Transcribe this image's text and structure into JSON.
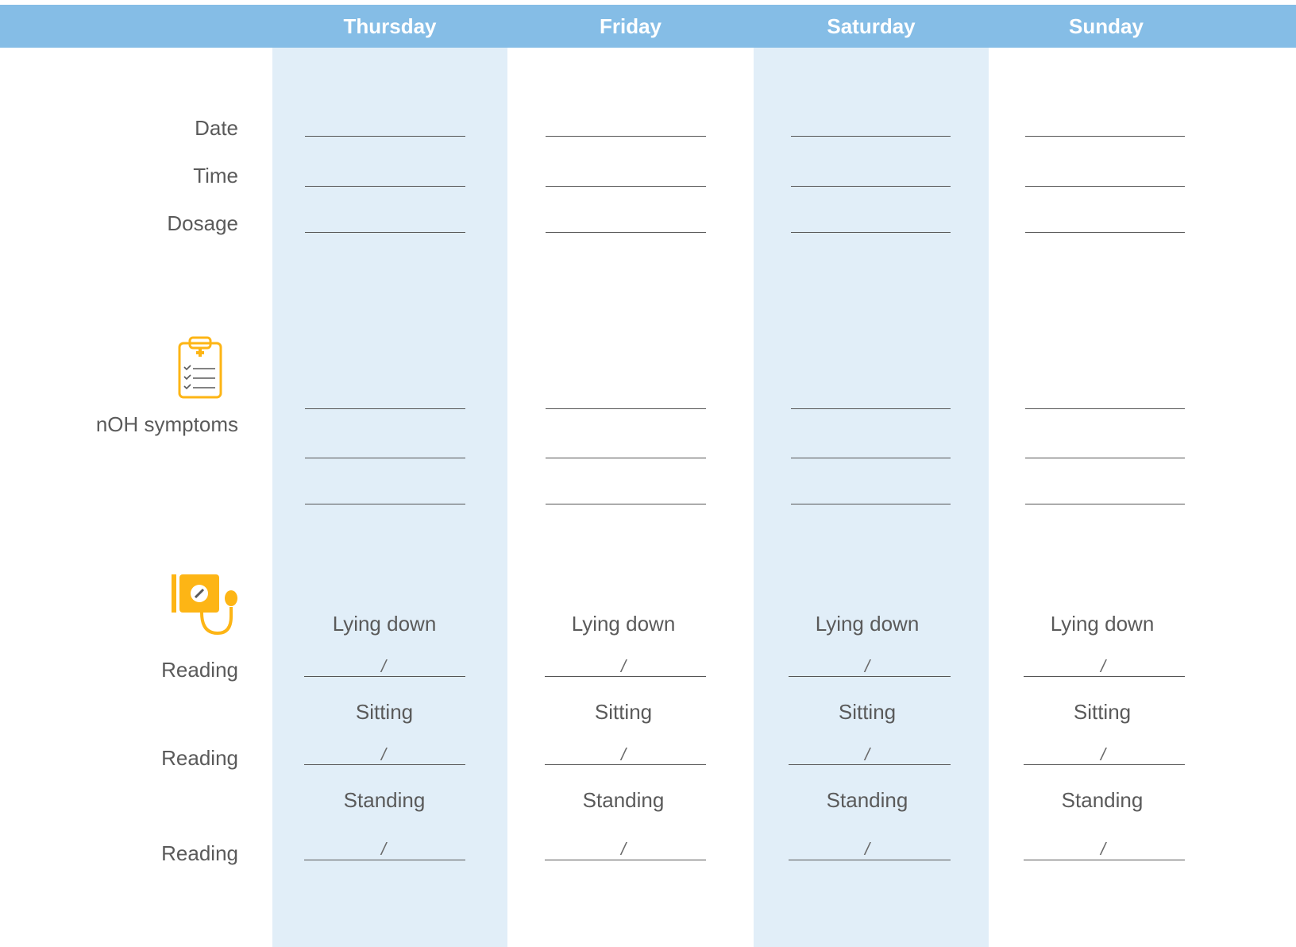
{
  "days": [
    "Thursday",
    "Friday",
    "Saturday",
    "Sunday"
  ],
  "rows": {
    "date": "Date",
    "time": "Time",
    "dosage": "Dosage",
    "symptoms": "nOH symptoms",
    "reading": "Reading"
  },
  "positions": {
    "lying": "Lying down",
    "sitting": "Sitting",
    "standing": "Standing"
  },
  "slash": "/",
  "icons": {
    "symptoms": "clipboard-checklist-icon",
    "blood_pressure": "blood-pressure-monitor-icon"
  },
  "colors": {
    "header": "#85bde6",
    "shaded_column": "#e1eef8",
    "icon_accent": "#fdb515"
  }
}
